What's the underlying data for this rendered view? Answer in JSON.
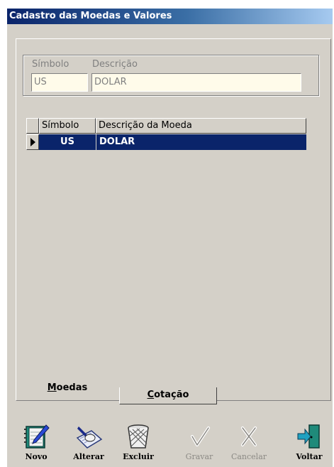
{
  "window": {
    "title": "Cadastro das Moedas e Valores"
  },
  "form": {
    "simbolo_label": "Símbolo",
    "descricao_label": "Descrição",
    "simbolo_value": "US",
    "descricao_value": "DOLAR"
  },
  "grid": {
    "columns": [
      "Símbolo",
      "Descrição da Moeda"
    ],
    "rows": [
      {
        "simbolo": "US",
        "descricao": "DOLAR",
        "selected": true
      }
    ]
  },
  "tabs": [
    {
      "mnemonic": "M",
      "rest": "oedas",
      "active": true
    },
    {
      "mnemonic": "C",
      "rest": "otação",
      "active": false
    }
  ],
  "toolbar": {
    "novo": "Novo",
    "alterar": "Alterar",
    "excluir": "Excluir",
    "gravar": "Gravar",
    "cancelar": "Cancelar",
    "voltar": "Voltar"
  },
  "icons": {
    "novo": "notebook-pen-icon",
    "alterar": "hand-writing-icon",
    "excluir": "wastebasket-icon",
    "gravar": "checkmark-icon",
    "cancelar": "x-mark-icon",
    "voltar": "exit-door-icon"
  },
  "colors": {
    "window_bg": "#d4d0c8",
    "title_bar": "#0a246a",
    "selection": "#0a246a",
    "field_bg": "#fffbea",
    "disabled_text": "#808080"
  }
}
